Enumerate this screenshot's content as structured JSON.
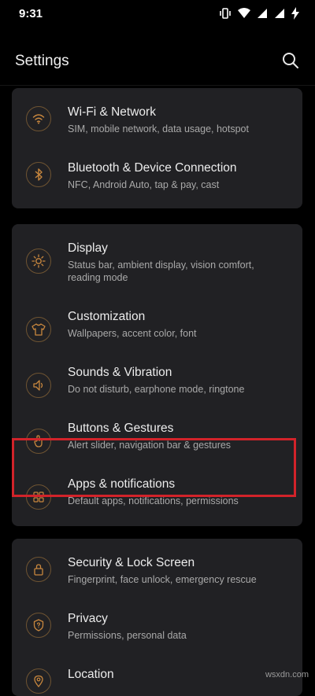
{
  "status_bar": {
    "time": "9:31"
  },
  "header": {
    "title": "Settings"
  },
  "colors": {
    "background": "#000000",
    "card": "#212124",
    "icon_accent": "#c8873e",
    "highlight_border": "#d2232a"
  },
  "groups": [
    {
      "items": [
        {
          "title": "Wi-Fi & Network",
          "subtitle": "SIM, mobile network, data usage, hotspot",
          "icon": "wifi-icon"
        },
        {
          "title": "Bluetooth & Device Connection",
          "subtitle": "NFC, Android Auto, tap & pay, cast",
          "icon": "bluetooth-icon"
        }
      ]
    },
    {
      "items": [
        {
          "title": "Display",
          "subtitle": "Status bar, ambient display, vision comfort, reading mode",
          "icon": "brightness-icon"
        },
        {
          "title": "Customization",
          "subtitle": "Wallpapers, accent color, font",
          "icon": "tshirt-icon"
        },
        {
          "title": "Sounds & Vibration",
          "subtitle": "Do not disturb, earphone mode, ringtone",
          "icon": "speaker-icon"
        },
        {
          "title": "Buttons & Gestures",
          "subtitle": "Alert slider, navigation bar & gestures",
          "icon": "gesture-icon"
        },
        {
          "title": "Apps & notifications",
          "subtitle": "Default apps, notifications, permissions",
          "icon": "apps-grid-icon"
        }
      ]
    },
    {
      "items": [
        {
          "title": "Security & Lock Screen",
          "subtitle": "Fingerprint, face unlock, emergency rescue",
          "icon": "lock-icon"
        },
        {
          "title": "Privacy",
          "subtitle": "Permissions, personal data",
          "icon": "shield-icon"
        },
        {
          "title": "Location",
          "subtitle": "",
          "icon": "location-icon"
        }
      ]
    }
  ],
  "watermark": "wsxdn.com"
}
